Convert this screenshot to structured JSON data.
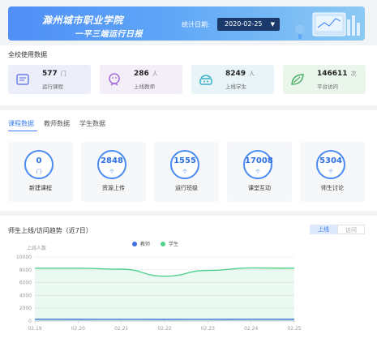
{
  "banner": {
    "title_line1": "滁州城市职业学院",
    "title_line2": "一平三端运行日报",
    "date_label": "统计日期:",
    "date_value": "2020-02-25"
  },
  "overview": {
    "title": "全校使用数据",
    "cards": [
      {
        "value": "577",
        "unit": "门",
        "label": "运行课程",
        "icon": "course-book-icon",
        "bg": "#eceffa",
        "fg": "#6f7ee8"
      },
      {
        "value": "286",
        "unit": "人",
        "label": "上线教师",
        "icon": "teacher-icon",
        "bg": "#f4eef9",
        "fg": "#a36ad8"
      },
      {
        "value": "8249",
        "unit": "人",
        "label": "上线学生",
        "icon": "student-icon",
        "bg": "#e8f4f7",
        "fg": "#35b1c9"
      },
      {
        "value": "146611",
        "unit": "次",
        "label": "平台访问",
        "icon": "platform-leaf-icon",
        "bg": "#eaf5ec",
        "fg": "#4caf63"
      }
    ]
  },
  "tabs": [
    {
      "label": "课程数据",
      "active": true
    },
    {
      "label": "教师数据",
      "active": false
    },
    {
      "label": "学生数据",
      "active": false
    }
  ],
  "metrics": [
    {
      "value": "0",
      "unit": "门",
      "label": "新建课程"
    },
    {
      "value": "2848",
      "unit": "个",
      "label": "资源上传"
    },
    {
      "value": "1555",
      "unit": "个",
      "label": "运行班级"
    },
    {
      "value": "17008",
      "unit": "个",
      "label": "课堂互动"
    },
    {
      "value": "5304",
      "unit": "个",
      "label": "师生讨论"
    }
  ],
  "trend": {
    "title": "师生上线/访问趋势（近7日）",
    "toggle": {
      "online": "上线",
      "visit": "访问",
      "selected": "上线"
    }
  },
  "colors": {
    "accent": "#3d7cf2",
    "teacher": "#3f6fe0",
    "student": "#52d18c"
  },
  "chart_data": {
    "type": "area",
    "ylabel": "上线人数",
    "ylim": [
      0,
      10000
    ],
    "yticks": [
      "0",
      "2000",
      "4000",
      "6000",
      "8000",
      "10000"
    ],
    "x": [
      "02.19",
      "02.20",
      "02.21",
      "02.22",
      "02.23",
      "02.24",
      "02.25"
    ],
    "series": [
      {
        "name": "教师",
        "values": [
          290,
          285,
          280,
          270,
          282,
          288,
          286
        ]
      },
      {
        "name": "学生",
        "values": [
          8250,
          8250,
          8100,
          7000,
          7900,
          8300,
          8249
        ]
      }
    ],
    "legend": "top-center",
    "grid": true
  }
}
